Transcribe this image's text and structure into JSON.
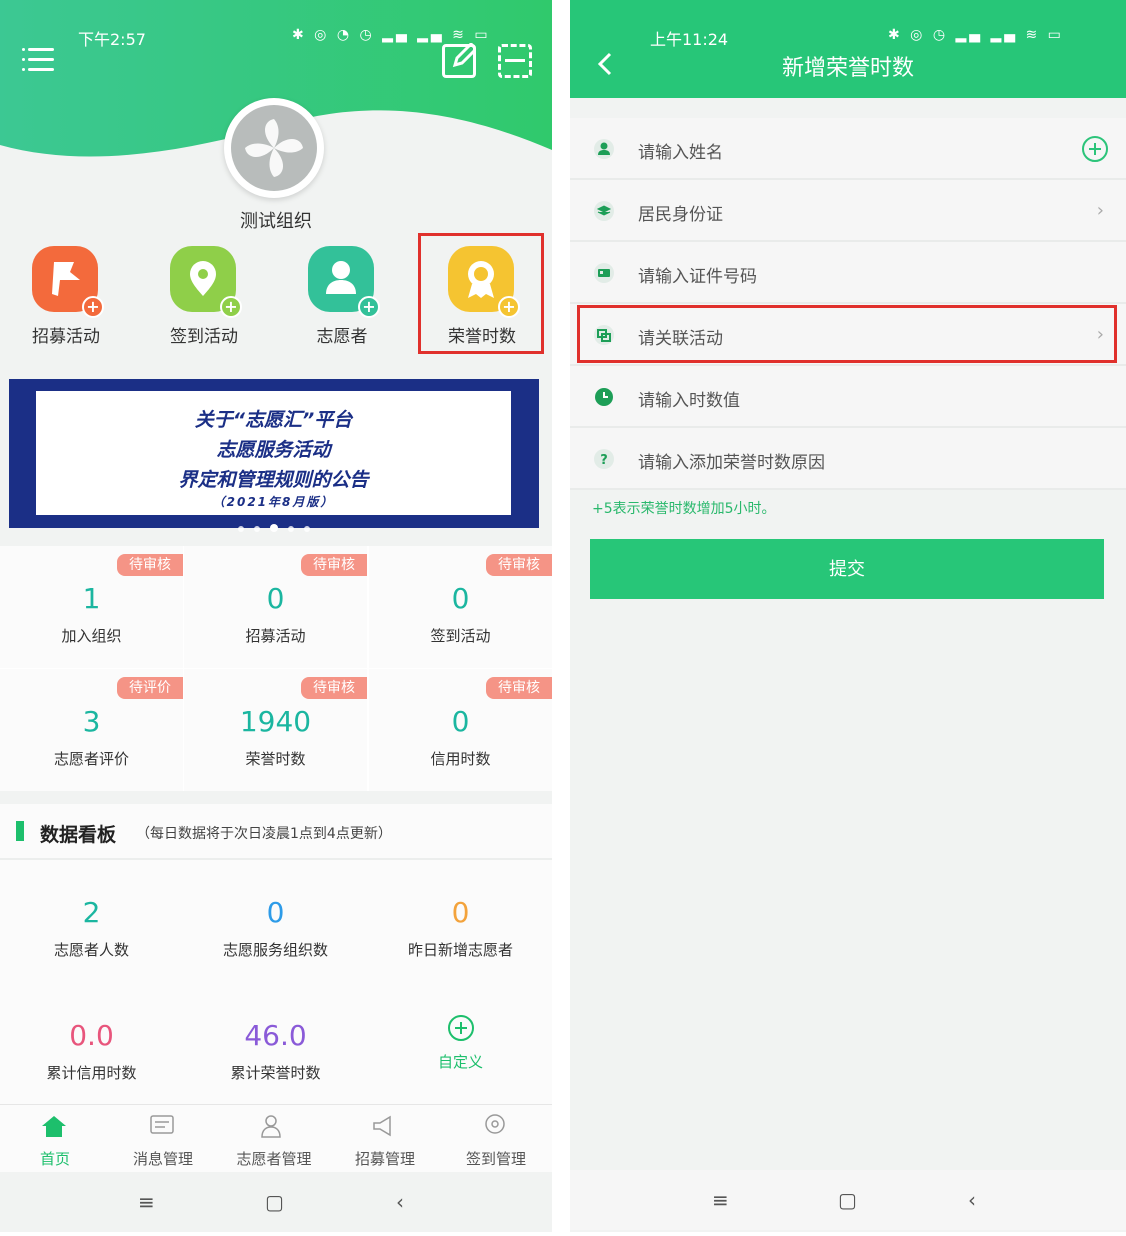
{
  "left": {
    "status_time": "下午2:57",
    "status_icons": "✱ ◎ ◔ ◷ ▂▄ ▂▄ ≋ ▭",
    "org_name": "测试组织",
    "quick_actions": [
      {
        "label": "招募活动",
        "icon": "flag-icon",
        "color": "#f36a3c"
      },
      {
        "label": "签到活动",
        "icon": "location-pin-icon",
        "color": "#8fcf49"
      },
      {
        "label": "志愿者",
        "icon": "person-icon",
        "color": "#33c199"
      },
      {
        "label": "荣誉时数",
        "icon": "medal-icon",
        "color": "#f5c431"
      }
    ],
    "banner": {
      "line1": "关于“志愿汇”平台",
      "line2": "志愿服务活动",
      "line3": "界定和管理规则的公告",
      "line4": "（2021年8月版）"
    },
    "stats": [
      {
        "value": "1",
        "label": "加入组织",
        "badge": "待审核"
      },
      {
        "value": "0",
        "label": "招募活动",
        "badge": "待审核"
      },
      {
        "value": "0",
        "label": "签到活动",
        "badge": "待审核"
      },
      {
        "value": "3",
        "label": "志愿者评价",
        "badge": "待评价"
      },
      {
        "value": "1940",
        "label": "荣誉时数",
        "badge": "待审核"
      },
      {
        "value": "0",
        "label": "信用时数",
        "badge": "待审核"
      }
    ],
    "board": {
      "title": "数据看板",
      "note": "（每日数据将于次日凌晨1点到4点更新）",
      "items": [
        {
          "value": "2",
          "label": "志愿者人数",
          "color": "#1bb6a0"
        },
        {
          "value": "0",
          "label": "志愿服务组织数",
          "color": "#2d9be8"
        },
        {
          "value": "0",
          "label": "昨日新增志愿者",
          "color": "#f3a33c"
        },
        {
          "value": "0.0",
          "label": "累计信用时数",
          "color": "#e8557c"
        },
        {
          "value": "46.0",
          "label": "累计荣誉时数",
          "color": "#8a5ad8"
        },
        {
          "value": "",
          "label": "自定义",
          "color": "#1dbf6c"
        }
      ]
    },
    "tabs": [
      {
        "label": "首页",
        "active": true
      },
      {
        "label": "消息管理"
      },
      {
        "label": "志愿者管理"
      },
      {
        "label": "招募管理"
      },
      {
        "label": "签到管理"
      }
    ]
  },
  "right": {
    "status_time": "上午11:24",
    "status_icons": "✱ ◎ ◷ ▂▄ ▂▄ ≋ ▭",
    "title": "新增荣誉时数",
    "rows": [
      {
        "text": "请输入姓名",
        "icon": "person-icon",
        "trail": "plus"
      },
      {
        "text": "居民身份证",
        "icon": "layers-icon",
        "trail": "chevron"
      },
      {
        "text": "请输入证件号码",
        "icon": "id-card-icon",
        "trail": ""
      },
      {
        "text": "请关联活动",
        "icon": "link-icon",
        "trail": "chevron"
      },
      {
        "text": "请输入时数值",
        "icon": "clock-icon",
        "trail": ""
      },
      {
        "text": "请输入添加荣誉时数原因",
        "icon": "question-icon",
        "trail": ""
      }
    ],
    "hint": "+5表示荣誉时数增加5小时。",
    "submit": "提交"
  },
  "nav": {
    "menu": "≡",
    "home": "▢",
    "back": "‹"
  }
}
